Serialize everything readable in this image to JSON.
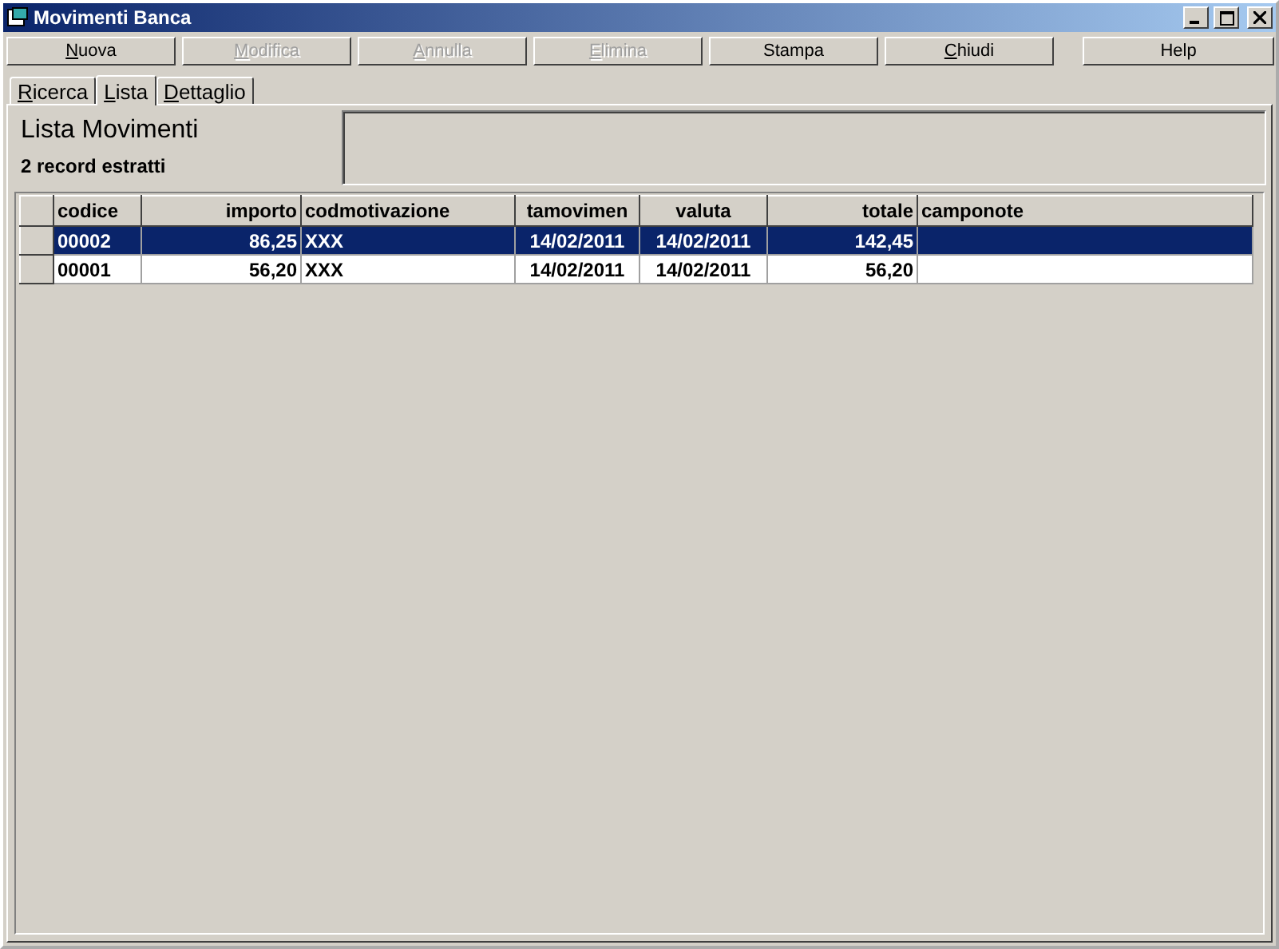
{
  "window": {
    "title": "Movimenti Banca"
  },
  "toolbar": [
    {
      "label": "Nuova",
      "disabled": false,
      "underline": true
    },
    {
      "label": "Modifica",
      "disabled": true,
      "underline": true
    },
    {
      "label": "Annulla",
      "disabled": true,
      "underline": true
    },
    {
      "label": "Elimina",
      "disabled": true,
      "underline": true
    },
    {
      "label": "Stampa",
      "disabled": false,
      "underline": false
    },
    {
      "label": "Chiudi",
      "disabled": false,
      "underline": true
    },
    {
      "label": "Help",
      "disabled": false,
      "underline": false
    }
  ],
  "tabs": [
    {
      "label": "Ricerca",
      "selected": false
    },
    {
      "label": "Lista",
      "selected": true
    },
    {
      "label": "Dettaglio",
      "selected": false
    }
  ],
  "header": {
    "title": "Lista Movimenti",
    "count": "2 record estratti"
  },
  "table": {
    "columns": [
      {
        "label": "codice"
      },
      {
        "label": "importo"
      },
      {
        "label": "codmotivazione"
      },
      {
        "label": "tamovimen"
      },
      {
        "label": "valuta"
      },
      {
        "label": "totale"
      },
      {
        "label": "camponote"
      }
    ],
    "rows": [
      {
        "selected": true,
        "cells": [
          "00002",
          "86,25",
          "XXX",
          "14/02/2011",
          "14/02/2011",
          "142,45",
          ""
        ]
      },
      {
        "selected": false,
        "cells": [
          "00001",
          "56,20",
          "XXX",
          "14/02/2011",
          "14/02/2011",
          "56,20",
          ""
        ]
      }
    ]
  }
}
